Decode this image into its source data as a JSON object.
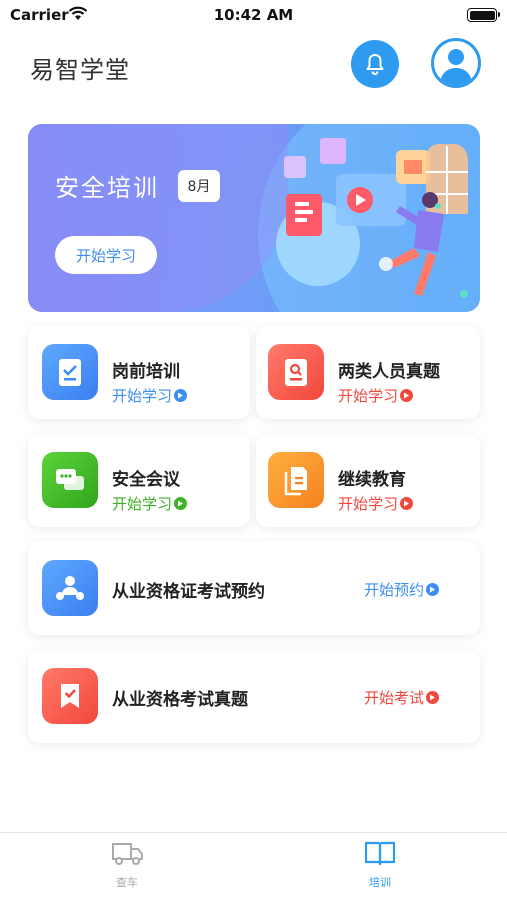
{
  "status_bar": {
    "carrier": "Carrier",
    "time": "10:42 AM"
  },
  "header": {
    "title": "易智学堂"
  },
  "banner": {
    "title": "安全培训",
    "badge": "8月",
    "button": "开始学习"
  },
  "cards": [
    {
      "name": "岗前培训",
      "action": "开始学习",
      "color": "#3b8ef0"
    },
    {
      "name": "两类人员真题",
      "action": "开始学习",
      "color": "#f2473c"
    },
    {
      "name": "安全会议",
      "action": "开始学习",
      "color": "#3fb227"
    },
    {
      "name": "继续教育",
      "action": "开始学习",
      "color": "#f2473c"
    }
  ],
  "wide_cards": [
    {
      "name": "从业资格证考试预约",
      "action": "开始预约",
      "color": "#3b8ef0"
    },
    {
      "name": "从业资格考试真题",
      "action": "开始考试",
      "color": "#f2473c"
    }
  ],
  "tabs": [
    {
      "label": "查车",
      "active": false
    },
    {
      "label": "培训",
      "active": true
    }
  ],
  "colors": {
    "accent": "#2f9bf0",
    "inactive": "#aaaaaa"
  }
}
